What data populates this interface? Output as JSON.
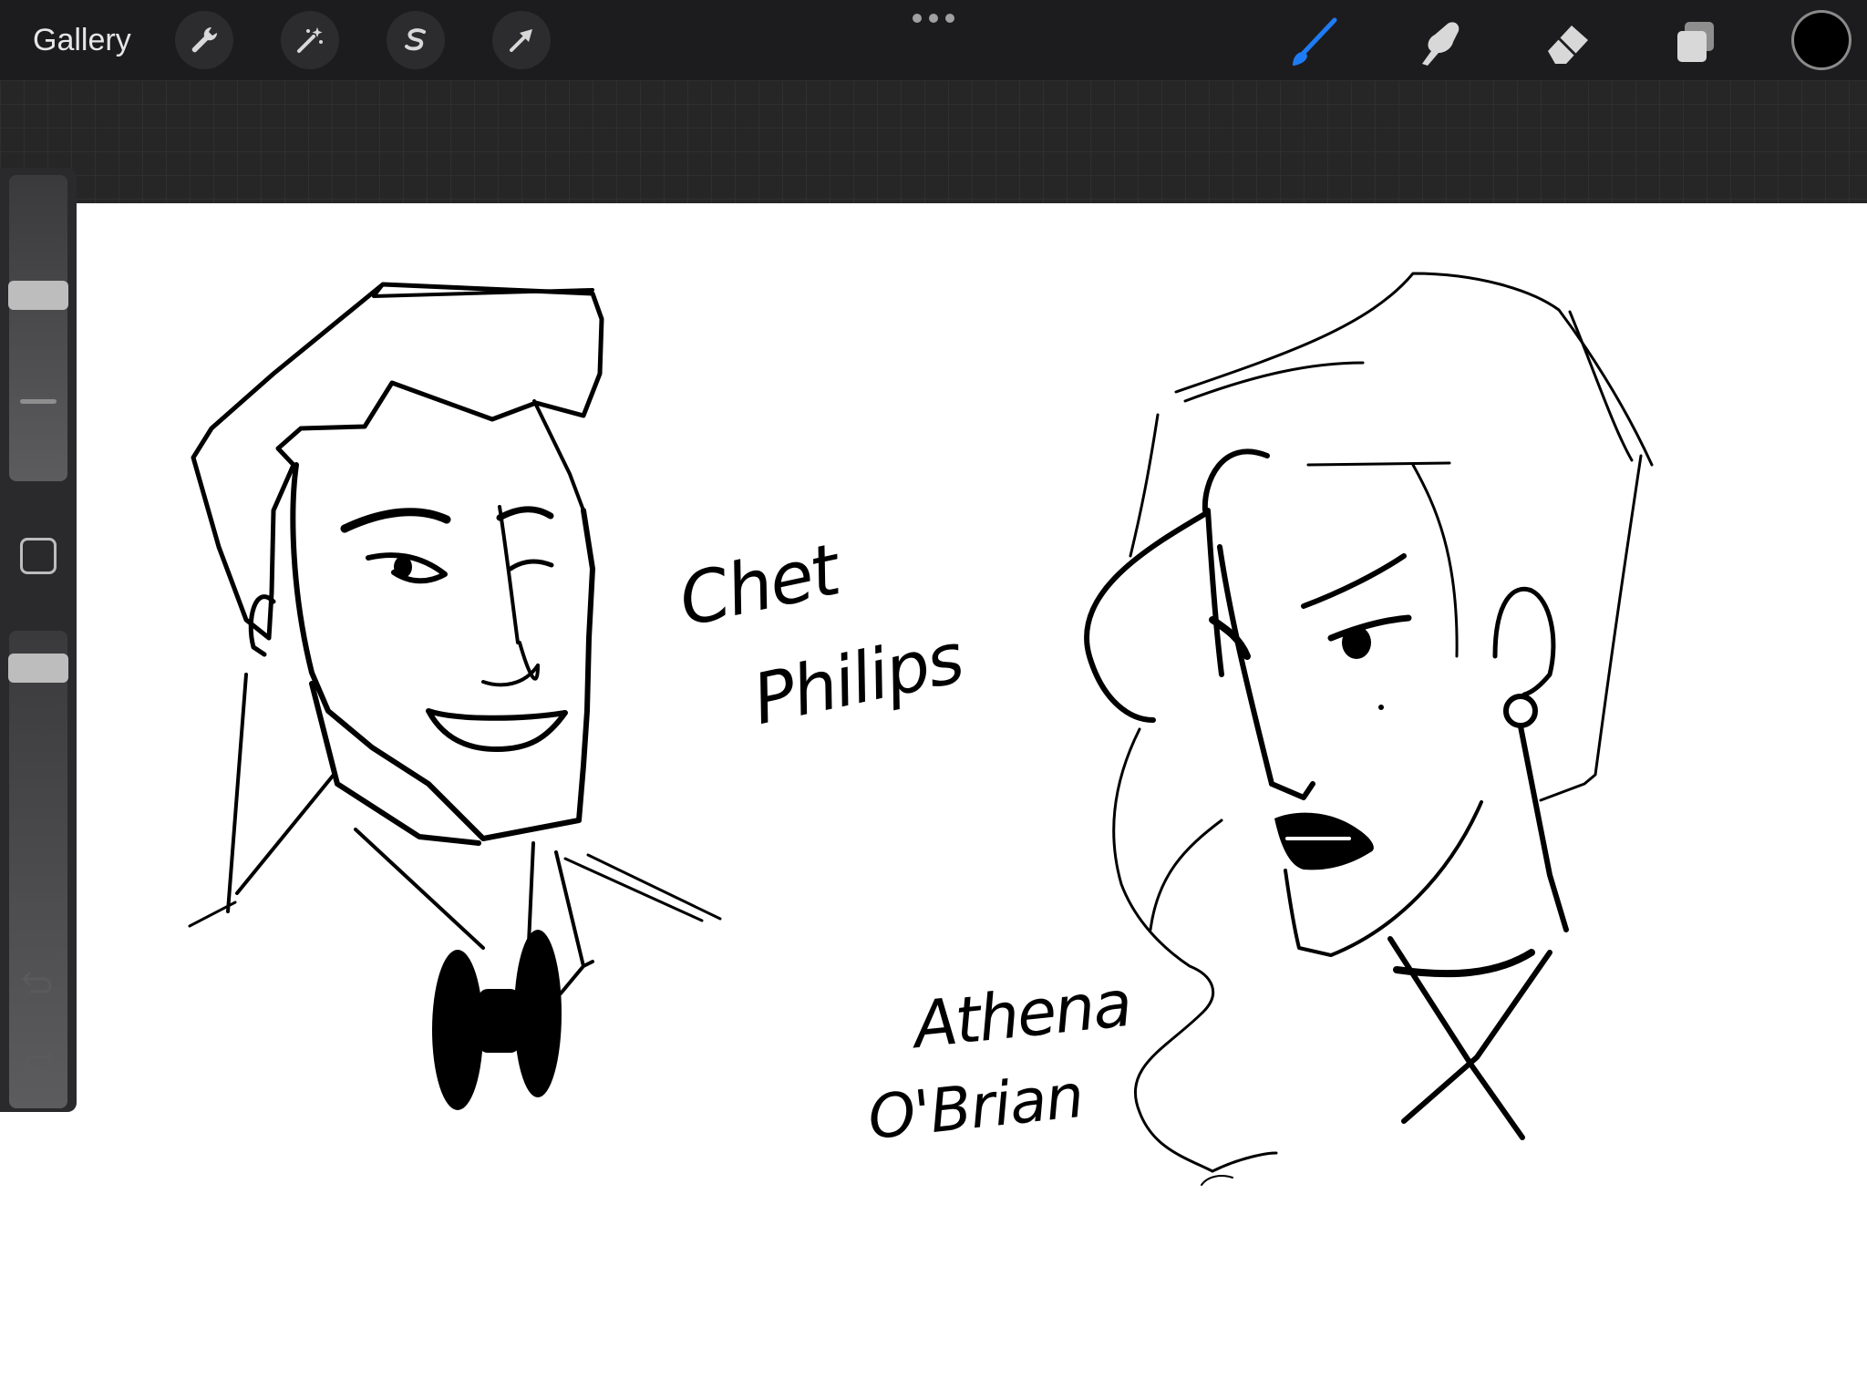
{
  "app": {
    "gallery_label": "Gallery"
  },
  "toolbar": {
    "left_tools": [
      {
        "name": "actions",
        "icon": "wrench-icon"
      },
      {
        "name": "adjustments",
        "icon": "magic-wand-icon"
      },
      {
        "name": "selection",
        "icon": "selection-s-icon"
      },
      {
        "name": "transform",
        "icon": "arrow-cursor-icon"
      }
    ],
    "more_icon": "ellipsis-icon",
    "right_tools": [
      {
        "name": "brush",
        "icon": "brush-icon",
        "active": true,
        "color": "#1e7bf2"
      },
      {
        "name": "smudge",
        "icon": "smudge-finger-icon",
        "active": false
      },
      {
        "name": "eraser",
        "icon": "eraser-icon",
        "active": false
      },
      {
        "name": "layers",
        "icon": "layers-icon",
        "active": false
      }
    ],
    "current_color": "#000000"
  },
  "sidebar": {
    "brush_size_level": 0.62,
    "brush_opacity_level": 0.95,
    "undo_icon": "undo-icon",
    "redo_icon": "redo-icon",
    "modify_icon": "square-icon"
  },
  "canvas": {
    "labels": {
      "character_1_first": "Chet",
      "character_1_last": "Philips",
      "character_2_first": "Athena",
      "character_2_last": "O'Brian"
    }
  }
}
